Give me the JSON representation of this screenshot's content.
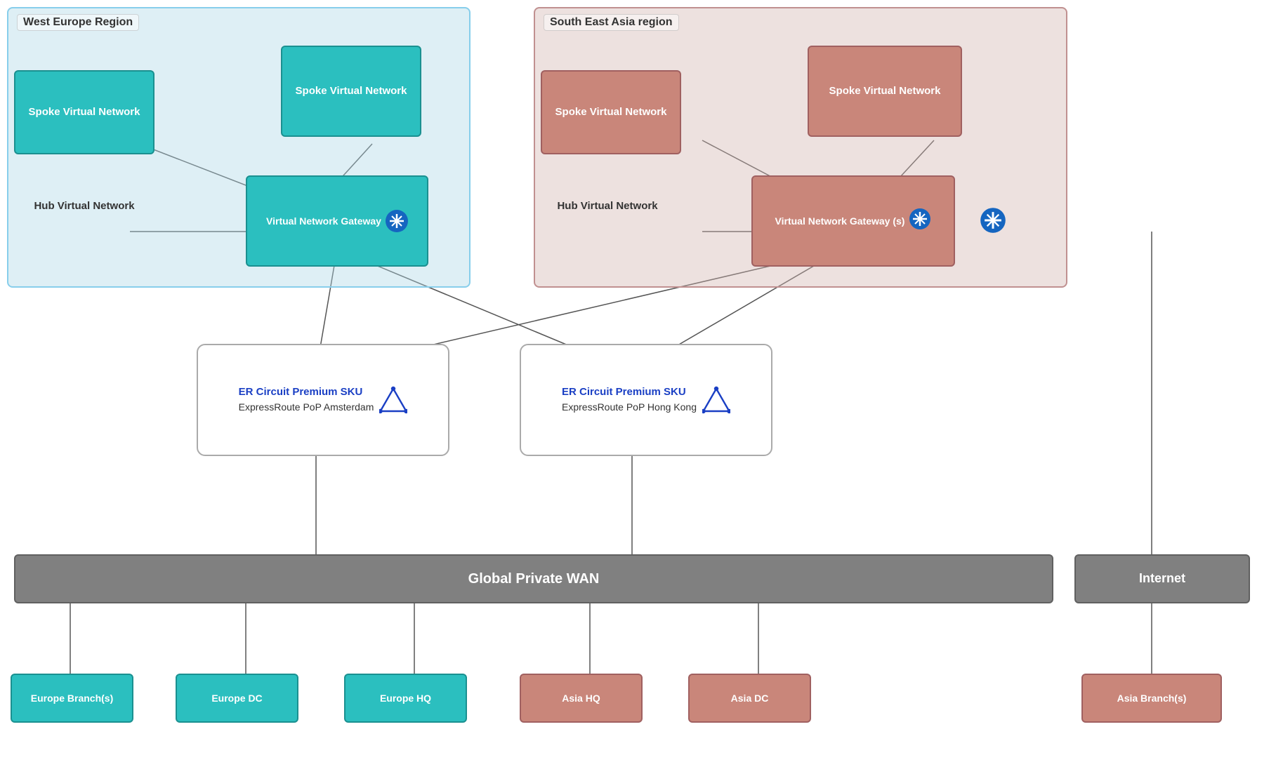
{
  "regions": {
    "west": {
      "label": "West Europe Region",
      "color": "teal"
    },
    "sea": {
      "label": "South East Asia region",
      "color": "pink"
    }
  },
  "nodes": {
    "spoke_west_left": "Spoke Virtual Network",
    "spoke_west_right": "Spoke Virtual Network",
    "hub_west": "Hub Virtual Network",
    "vng_west": "Virtual Network Gateway",
    "spoke_sea_left": "Spoke Virtual Network",
    "spoke_sea_right": "Spoke Virtual Network",
    "hub_sea": "Hub Virtual Network",
    "vng_sea": "Virtual Network Gateway (s)",
    "er_amsterdam_title": "ER Circuit Premium SKU",
    "er_amsterdam_pop": "ExpressRoute PoP Amsterdam",
    "er_hongkong_title": "ER Circuit Premium SKU",
    "er_hongkong_pop": "ExpressRoute PoP Hong Kong",
    "global_wan": "Global Private WAN",
    "internet": "Internet",
    "europe_branch": "Europe Branch(s)",
    "europe_dc": "Europe DC",
    "europe_hq": "Europe HQ",
    "asia_hq": "Asia HQ",
    "asia_dc": "Asia DC",
    "asia_branch": "Asia Branch(s)"
  }
}
